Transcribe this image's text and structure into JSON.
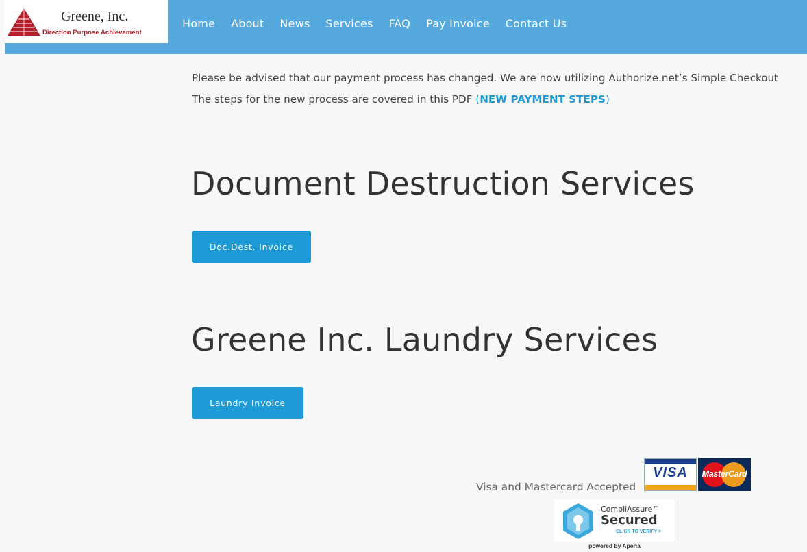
{
  "logo": {
    "name": "Greene, Inc.",
    "tagline": "Direction  Purpose  Achievement"
  },
  "nav": {
    "items": [
      "Home",
      "About",
      "News",
      "Services",
      "FAQ",
      "Pay Invoice",
      "Contact Us"
    ]
  },
  "notice": {
    "line1": "Please be advised that our payment process has changed. We are now utilizing Authorize.net’s Simple Checkout",
    "line2_prefix": "The steps for the new process are covered in this PDF ",
    "paren_open": "(",
    "link_text": "NEW PAYMENT STEPS",
    "paren_close": ")"
  },
  "sections": [
    {
      "title": "Document Destruction Services",
      "button_label": "Doc.Dest. Invoice"
    },
    {
      "title": "Greene Inc. Laundry Services",
      "button_label": "Laundry Invoice"
    }
  ],
  "footer": {
    "accepted_text": "Visa and Mastercard Accepted",
    "visa_logo_text": "VISA",
    "mastercard_logo_text": "MasterCard",
    "compliassure_name": "CompliAssure™",
    "compliassure_secured": "Secured",
    "compliassure_verify": "CLICK TO VERIFY >",
    "powered_by": "powered by Aperia"
  },
  "colors": {
    "header_bg": "#55a9dd",
    "accent": "#1e9ad6",
    "logo_red": "#b3202a"
  }
}
